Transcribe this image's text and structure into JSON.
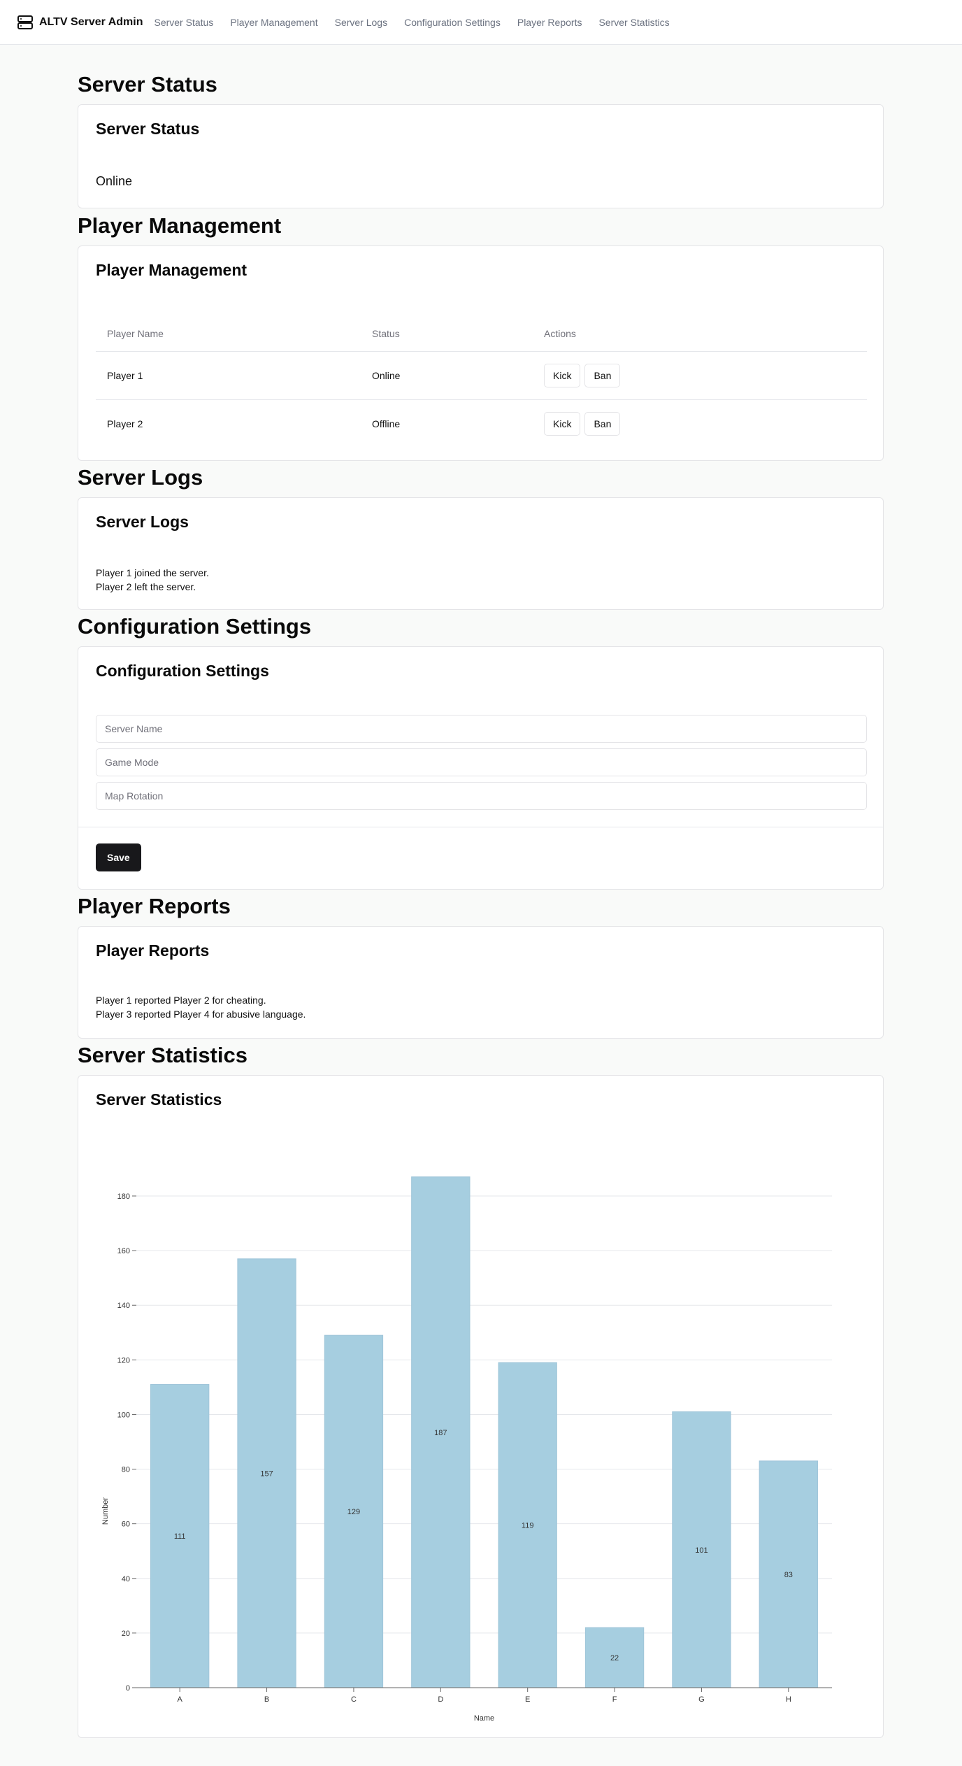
{
  "nav": {
    "brand": "ALTV Server Admin",
    "brand_icon": "server-icon",
    "links": [
      "Server Status",
      "Player Management",
      "Server Logs",
      "Configuration Settings",
      "Player Reports",
      "Server Statistics"
    ]
  },
  "server_status": {
    "heading": "Server Status",
    "card_title": "Server Status",
    "status": "Online"
  },
  "player_management": {
    "heading": "Player Management",
    "card_title": "Player Management",
    "columns": [
      "Player Name",
      "Status",
      "Actions"
    ],
    "rows": [
      {
        "name": "Player 1",
        "status": "Online",
        "kick": "Kick",
        "ban": "Ban"
      },
      {
        "name": "Player 2",
        "status": "Offline",
        "kick": "Kick",
        "ban": "Ban"
      }
    ]
  },
  "server_logs": {
    "heading": "Server Logs",
    "card_title": "Server Logs",
    "lines": [
      "Player 1 joined the server.",
      "Player 2 left the server."
    ]
  },
  "configuration": {
    "heading": "Configuration Settings",
    "card_title": "Configuration Settings",
    "fields": {
      "server_name": {
        "placeholder": "Server Name",
        "value": ""
      },
      "game_mode": {
        "placeholder": "Game Mode",
        "value": ""
      },
      "map_rotation": {
        "placeholder": "Map Rotation",
        "value": ""
      }
    },
    "save_label": "Save"
  },
  "player_reports": {
    "heading": "Player Reports",
    "card_title": "Player Reports",
    "lines": [
      "Player 1 reported Player 2 for cheating.",
      "Player 3 reported Player 4 for abusive language."
    ]
  },
  "server_statistics": {
    "heading": "Server Statistics",
    "card_title": "Server Statistics"
  },
  "chart_data": {
    "type": "bar",
    "categories": [
      "A",
      "B",
      "C",
      "D",
      "E",
      "F",
      "G",
      "H"
    ],
    "values": [
      111,
      157,
      129,
      187,
      119,
      22,
      101,
      83
    ],
    "title": "",
    "xlabel": "Name",
    "ylabel": "Number",
    "ylim": [
      0,
      180
    ],
    "yticks": [
      0,
      20,
      40,
      60,
      80,
      100,
      120,
      140,
      160,
      180
    ],
    "grid": true,
    "bar_color": "#a6cee0",
    "data_labels": true
  },
  "colors": {
    "background": "#f9faf9",
    "card": "#ffffff",
    "border": "#e4e4e7",
    "muted_text": "#6b7280",
    "primary_button": "#18181b"
  }
}
